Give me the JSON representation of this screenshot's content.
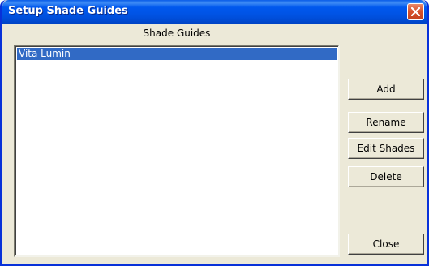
{
  "window": {
    "title": "Setup Shade Guides"
  },
  "list": {
    "label": "Shade Guides",
    "items": [
      {
        "label": "Vita Lumin",
        "selected": true
      }
    ]
  },
  "buttons": {
    "add": "Add",
    "rename": "Rename",
    "edit_shades": "Edit Shades",
    "delete": "Delete",
    "close": "Close"
  },
  "colors": {
    "titlebar": "#0058ee",
    "selection": "#316ac5",
    "dialog_face": "#ece9d8",
    "close_button": "#d8522e"
  },
  "icons": {
    "close": "close-icon"
  }
}
